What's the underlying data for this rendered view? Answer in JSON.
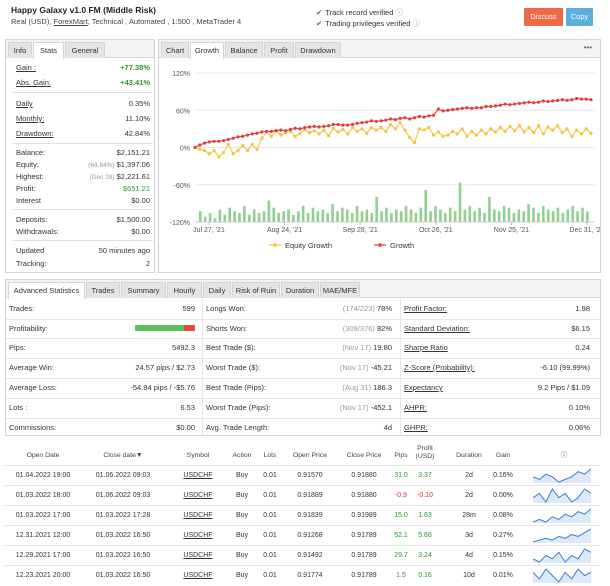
{
  "header": {
    "title": "Happy Galaxy v1.0 FM (Middle Risk)",
    "subtitle_pre": "Real (USD),",
    "broker": "ForexMart",
    "subtitle_post": ", Technical , Automated , 1:500 , MetaTrader 4",
    "verified_track": "Track record verified",
    "verified_trading": "Trading privileges verified",
    "discuss": "Discuss",
    "copy": "Copy"
  },
  "stats_tabs": [
    "Info",
    "Stats",
    "General"
  ],
  "stats": {
    "gain_label": "Gain :",
    "gain": "+77.38%",
    "abs_gain_label": "Abs. Gain:",
    "abs_gain": "+43.41%",
    "daily_label": "Daily",
    "daily": "0.35%",
    "monthly_label": "Monthly:",
    "monthly": "11.10%",
    "drawdown_label": "Drawdown:",
    "drawdown": "42.84%",
    "balance_label": "Balance:",
    "balance": "$2,151.21",
    "equity_label": "Equity:",
    "equity_note": "(64.94%)",
    "equity": "$1,397.06",
    "highest_label": "Highest:",
    "highest_note": "(Dec 28)",
    "highest": "$2,221.61",
    "profit_label": "Profit:",
    "profit": "$651.21",
    "interest_label": "Interest",
    "interest": "$0.00",
    "deposits_label": "Deposits:",
    "deposits": "$1,500.00",
    "withdrawals_label": "Withdrawals:",
    "withdrawals": "$0.00",
    "updated_label": "Updated",
    "updated": "50 minutes ago",
    "tracking_label": "Tracking:",
    "tracking": "2"
  },
  "chart_tabs": [
    "Chart",
    "Growth",
    "Balance",
    "Profit",
    "Drawdown"
  ],
  "chart_menu": "•••",
  "chart_data": {
    "type": "line",
    "x_labels": [
      "Jul 27, '21",
      "Aug 24, '21",
      "Sep 28, '21",
      "Oct 26, '21",
      "Nov 25, '21",
      "Dec 31, '21"
    ],
    "y_ticks": [
      "120%",
      "60%",
      "0%",
      "-60%",
      "-120%"
    ],
    "ylim": [
      -120,
      120
    ],
    "legend": [
      "Equity Growth",
      "Growth"
    ],
    "colors": {
      "equity": "#f5c242",
      "growth": "#e04040",
      "bars": "#8fd18f"
    },
    "series": [
      {
        "name": "Growth",
        "values": [
          0,
          4,
          7,
          9,
          10,
          10,
          11,
          13,
          15,
          17,
          18,
          20,
          22,
          23,
          25,
          26,
          26,
          27,
          28,
          27,
          29,
          31,
          30,
          32,
          33,
          34,
          33,
          34,
          35,
          37,
          37,
          36,
          36,
          37,
          39,
          40,
          41,
          43,
          42,
          43,
          44,
          46,
          45,
          47,
          48,
          46,
          48,
          50,
          49,
          51,
          52,
          62,
          59,
          60,
          61,
          62,
          63,
          64,
          63,
          64,
          64,
          66,
          66,
          67,
          68,
          70,
          69,
          70,
          71,
          72,
          73,
          72,
          73,
          75,
          74,
          75,
          76,
          77,
          76,
          77,
          79,
          78,
          78,
          77
        ]
      },
      {
        "name": "Equity Growth",
        "values": [
          0,
          -3,
          -5,
          -10,
          -5,
          -15,
          -8,
          5,
          -10,
          -5,
          3,
          -5,
          5,
          -3,
          15,
          25,
          18,
          27,
          20,
          24,
          26,
          18,
          22,
          29,
          24,
          27,
          22,
          28,
          19,
          31,
          25,
          29,
          22,
          32,
          26,
          30,
          23,
          32,
          28,
          32,
          26,
          37,
          30,
          40,
          28,
          16,
          8,
          30,
          28,
          32,
          20,
          25,
          18,
          20,
          26,
          22,
          30,
          18,
          26,
          20,
          28,
          22,
          30,
          25,
          32,
          26,
          34,
          27,
          35,
          25,
          32,
          24,
          35,
          22,
          33,
          28,
          35,
          24,
          30,
          18,
          28,
          22,
          30,
          23
        ]
      }
    ],
    "bars": [
      6,
      3,
      5,
      2,
      7,
      4,
      8,
      6,
      5,
      9,
      4,
      7,
      5,
      6,
      12,
      8,
      5,
      6,
      7,
      4,
      6,
      9,
      5,
      8,
      6,
      7,
      5,
      10,
      6,
      8,
      7,
      5,
      9,
      6,
      7,
      5,
      14,
      6,
      8,
      5,
      7,
      6,
      9,
      7,
      5,
      8,
      18,
      6,
      9,
      7,
      5,
      8,
      6,
      22,
      7,
      9,
      6,
      8,
      5,
      14,
      7,
      6,
      9,
      8,
      5,
      7,
      6,
      10,
      8,
      5,
      9,
      7,
      6,
      8,
      5,
      7,
      9,
      6,
      8,
      6
    ]
  },
  "adv_tabs": [
    "Advanced Statistics",
    "Trades",
    "Summary",
    "Hourly",
    "Daily",
    "Risk of Ruin",
    "Duration",
    "MAE/MFE"
  ],
  "adv": {
    "col1": [
      {
        "label": "Trades:",
        "value": "599"
      },
      {
        "label": "Profitability:",
        "value": ""
      },
      {
        "label": "Pips:",
        "value": "5492.3"
      },
      {
        "label": "Average Win:",
        "value": "24.57 pips / $2.73"
      },
      {
        "label": "Average Loss:",
        "value": "-54.94 pips / -$5.76"
      },
      {
        "label": "Lots :",
        "value": "6.53"
      },
      {
        "label": "Commissions:",
        "value": "$0.00"
      }
    ],
    "col2": [
      {
        "label": "Longs Won:",
        "note": "(174/223)",
        "value": "78%"
      },
      {
        "label": "Shorts Won:",
        "note": "(309/376)",
        "value": "82%"
      },
      {
        "label": "Best Trade ($):",
        "note": "(Nov 17)",
        "value": "19.80"
      },
      {
        "label": "Worst Trade ($):",
        "note": "(Nov 17)",
        "value": "-45.21"
      },
      {
        "label": "Best Trade (Pips):",
        "note": "(Aug 31)",
        "value": "186.3"
      },
      {
        "label": "Worst Trade (Pips):",
        "note": "(Nov 17)",
        "value": "-452.1"
      },
      {
        "label": "Avg. Trade Length:",
        "note": "",
        "value": "4d"
      }
    ],
    "col3": [
      {
        "label": "Profit Factor:",
        "value": "1.98"
      },
      {
        "label": "Standard Deviation:",
        "value": "$6.15"
      },
      {
        "label": "Sharpe Ratio",
        "value": "0.24"
      },
      {
        "label": "Z-Score (Probability):",
        "value": "-6.10 (99.99%)"
      },
      {
        "label": "Expectancy",
        "value": "9.2 Pips / $1.09"
      },
      {
        "label": "AHPR:",
        "value": "0.10%"
      },
      {
        "label": "GHPR:",
        "value": "0.06%"
      }
    ],
    "profitability_win_fraction": 0.81
  },
  "trades": {
    "headers": [
      "Open Date",
      "Close date▼",
      "Symbol",
      "Action",
      "Lots",
      "Open Price",
      "Close Price",
      "Pips",
      "Profit\n(USD)",
      "Duration",
      "Gain",
      "ⓘ"
    ],
    "rows": [
      {
        "open": "01.04.2022 19:00",
        "close": "01.06.2022 09:03",
        "symbol": "USDCHF",
        "action": "Buy",
        "lots": "0.01",
        "open_price": "0.91570",
        "close_price": "0.91880",
        "pips": "31.0",
        "profit": "3.37",
        "duration": "2d",
        "gain": "0.16%",
        "sign": "pos",
        "spark": [
          5,
          4,
          6,
          5,
          3,
          4,
          5,
          7,
          6,
          8
        ]
      },
      {
        "open": "01.03.2022 18:00",
        "close": "01.06.2022 09:03",
        "symbol": "USDCHF",
        "action": "Buy",
        "lots": "0.01",
        "open_price": "0.91889",
        "close_price": "0.91880",
        "pips": "-0.9",
        "profit": "-0.10",
        "duration": "2d",
        "gain": "0.00%",
        "sign": "neg",
        "spark": [
          4,
          5,
          3,
          6,
          4,
          5,
          3,
          4,
          6,
          5
        ]
      },
      {
        "open": "01.03.2022 17:00",
        "close": "01.03.2022 17:28",
        "symbol": "USDCHF",
        "action": "Buy",
        "lots": "0.01",
        "open_price": "0.91839",
        "close_price": "0.91989",
        "pips": "15.0",
        "profit": "1.63",
        "duration": "28m",
        "gain": "0.08%",
        "sign": "pos",
        "spark": [
          3,
          4,
          3,
          5,
          4,
          6,
          5,
          7,
          6,
          8
        ]
      },
      {
        "open": "12.31.2021 12:00",
        "close": "01.03.2022 16:50",
        "symbol": "USDCHF",
        "action": "Buy",
        "lots": "0.01",
        "open_price": "0.91268",
        "close_price": "0.91789",
        "pips": "52.1",
        "profit": "5.68",
        "duration": "3d",
        "gain": "0.27%",
        "sign": "pos",
        "spark": [
          2,
          3,
          4,
          3,
          5,
          4,
          6,
          5,
          7,
          9
        ]
      },
      {
        "open": "12.29.2021 17:00",
        "close": "01.03.2022 16:50",
        "symbol": "USDCHF",
        "action": "Buy",
        "lots": "0.01",
        "open_price": "0.91492",
        "close_price": "0.91789",
        "pips": "29.7",
        "profit": "3.24",
        "duration": "4d",
        "gain": "0.15%",
        "sign": "pos",
        "spark": [
          4,
          3,
          5,
          4,
          6,
          3,
          5,
          4,
          7,
          6
        ]
      },
      {
        "open": "12.23.2021 20:00",
        "close": "01.03.2022 16:50",
        "symbol": "USDCHF",
        "action": "Buy",
        "lots": "0.01",
        "open_price": "0.91774",
        "close_price": "0.91789",
        "pips": "1.5",
        "profit": "0.16",
        "duration": "10d",
        "gain": "0.01%",
        "sign": "pos",
        "spark": [
          5,
          3,
          6,
          4,
          2,
          5,
          3,
          6,
          4,
          5
        ]
      }
    ]
  }
}
